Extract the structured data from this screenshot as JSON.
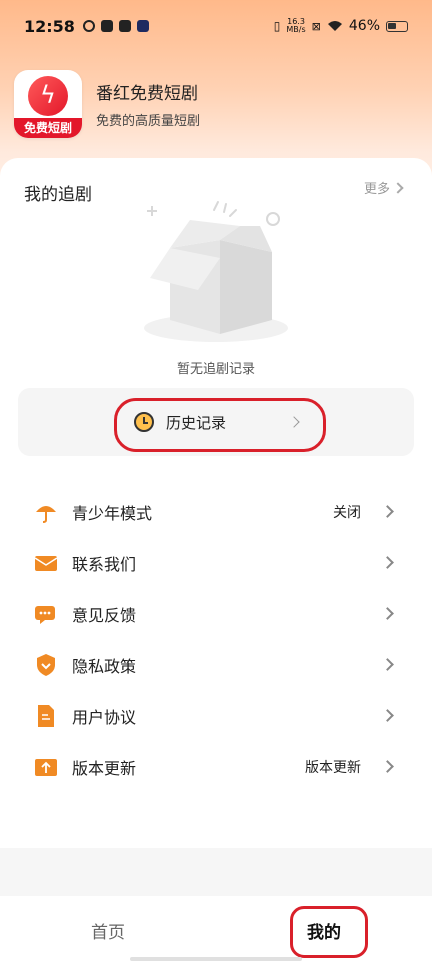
{
  "status_bar": {
    "time": "12:58",
    "network_speed_value": "16.3",
    "network_speed_unit": "MB/s",
    "battery": "46%"
  },
  "app": {
    "name": "番红免费短剧",
    "slogan": "免费的高质量短剧",
    "logo_label": "免费短剧",
    "accent_color": "#e3172a"
  },
  "watchlist": {
    "title": "我的追剧",
    "more_label": "更多",
    "empty_text": "暂无追剧记录"
  },
  "history": {
    "label": "历史记录"
  },
  "menu": {
    "items": [
      {
        "label": "青少年模式",
        "value": "关闭",
        "icon": "umbrella-icon"
      },
      {
        "label": "联系我们",
        "value": "",
        "icon": "mail-icon"
      },
      {
        "label": "意见反馈",
        "value": "",
        "icon": "chat-icon"
      },
      {
        "label": "隐私政策",
        "value": "",
        "icon": "shield-icon"
      },
      {
        "label": "用户协议",
        "value": "",
        "icon": "document-icon"
      },
      {
        "label": "版本更新",
        "value": "版本更新",
        "icon": "upload-icon"
      }
    ],
    "icon_color": "#f08a24"
  },
  "tabs": {
    "home": "首页",
    "mine": "我的",
    "active": "mine"
  },
  "highlight_color": "#d9202a"
}
